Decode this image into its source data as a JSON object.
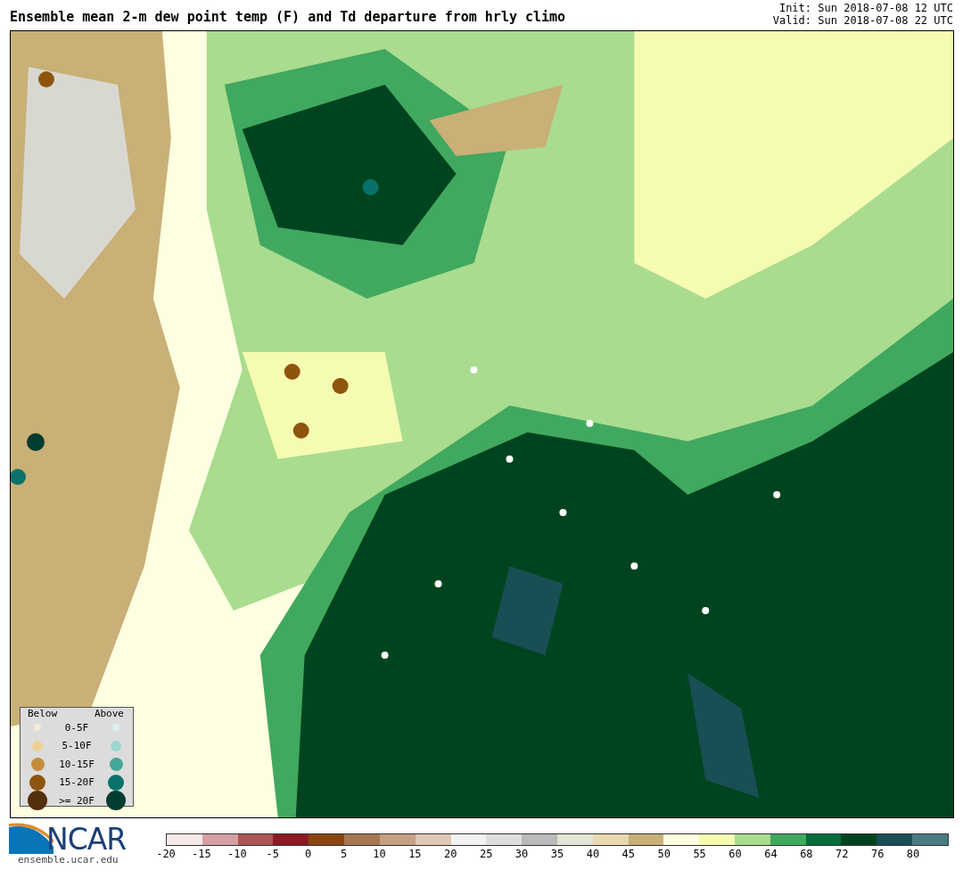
{
  "title": "Ensemble mean 2-m dew point temp (F) and Td departure from hrly climo",
  "init": "Init: Sun 2018-07-08 12 UTC",
  "valid": "Valid: Sun 2018-07-08 22 UTC",
  "legend": {
    "below_heading": "Below",
    "above_heading": "Above",
    "rows": [
      {
        "label": "0-5F",
        "below": {
          "color": "#f3ead8"
        },
        "above": {
          "color": "#dceeee"
        }
      },
      {
        "label": "5-10F",
        "below": {
          "color": "#ecd298"
        },
        "above": {
          "color": "#9ad8d0"
        }
      },
      {
        "label": "10-15F",
        "below": {
          "color": "#c68c3e"
        },
        "above": {
          "color": "#46a698"
        }
      },
      {
        "label": "15-20F",
        "below": {
          "color": "#8e540e"
        },
        "above": {
          "color": "#08726a"
        }
      },
      {
        "label": ">= 20F",
        "below": {
          "color": "#54300a"
        },
        "above": {
          "color": "#003c30"
        }
      }
    ]
  },
  "logo": {
    "text": "NCAR",
    "url": "ensemble.ucar.edu"
  },
  "colorbar": {
    "segments": [
      {
        "color": "#f5e9ea"
      },
      {
        "color": "#d4a0a4"
      },
      {
        "color": "#ad5456"
      },
      {
        "color": "#8b1a22"
      },
      {
        "color": "#8a4510"
      },
      {
        "color": "#a87552"
      },
      {
        "color": "#c4a085"
      },
      {
        "color": "#dfc8b6"
      },
      {
        "color": "#f2f2f2"
      },
      {
        "color": "#dedede"
      },
      {
        "color": "#bababa"
      },
      {
        "color": "#e5e5d5"
      },
      {
        "color": "#e8d9b0"
      },
      {
        "color": "#c8b077"
      },
      {
        "color": "#fefee0"
      },
      {
        "color": "#f6fbb2"
      },
      {
        "color": "#a9dc8e"
      },
      {
        "color": "#41a85f"
      },
      {
        "color": "#006d3a"
      },
      {
        "color": "#00441f"
      },
      {
        "color": "#1a4e55"
      },
      {
        "color": "#4a7b80"
      }
    ],
    "ticks": [
      "-20",
      "-15",
      "-10",
      "-5",
      "0",
      "5",
      "10",
      "15",
      "20",
      "25",
      "30",
      "35",
      "40",
      "45",
      "50",
      "55",
      "60",
      "64",
      "68",
      "72",
      "76",
      "80"
    ]
  }
}
